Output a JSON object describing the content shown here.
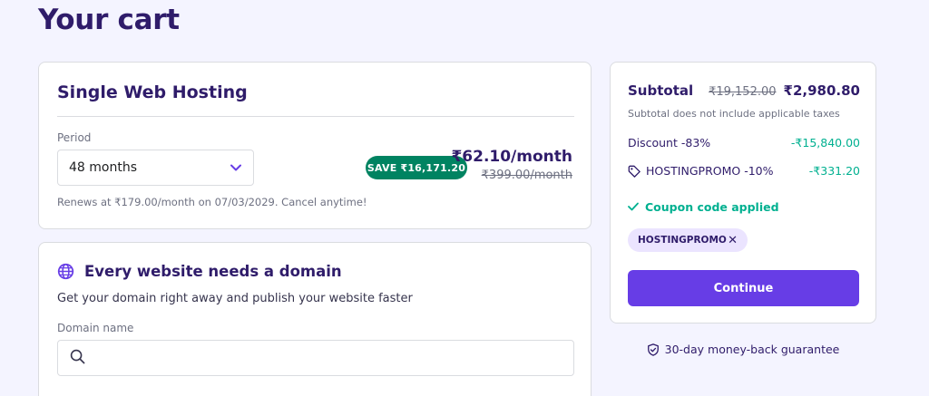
{
  "page": {
    "title": "Your cart"
  },
  "colors": {
    "accent": "#673de6",
    "brand_dark": "#2f1c6a",
    "success": "#00b090",
    "save_badge": "#008361",
    "background": "#f4f4ff"
  },
  "plan": {
    "name": "Single Web Hosting",
    "period_label": "Period",
    "period_value": "48 months",
    "period_icon": "chevron-down-icon",
    "save_badge": "SAVE ₹16,171.20",
    "price": "₹62.10/month",
    "old_price": "₹399.00/month",
    "renew_text": "Renews at ₹179.00/month on 07/03/2029. Cancel anytime!"
  },
  "domain": {
    "icon": "globe-icon",
    "title": "Every website needs a domain",
    "subtitle": "Get your domain right away and publish your website faster",
    "input_label": "Domain name",
    "input_value": "",
    "search_icon": "search-icon"
  },
  "summary": {
    "subtotal_label": "Subtotal",
    "subtotal_old": "₹19,152.00",
    "subtotal_new": "₹2,980.80",
    "tax_note": "Subtotal does not include applicable taxes",
    "discount_label": "Discount -83%",
    "discount_value": "-₹15,840.00",
    "promo_icon": "tag-icon",
    "promo_label": "HOSTINGPROMO -10%",
    "promo_value": "-₹331.20",
    "coupon_applied": "Coupon code applied",
    "coupon_chip": "HOSTINGPROMO",
    "remove_icon": "close-icon",
    "continue_label": "Continue"
  },
  "guarantee": {
    "icon": "shield-check-icon",
    "text": "30-day money-back guarantee"
  }
}
